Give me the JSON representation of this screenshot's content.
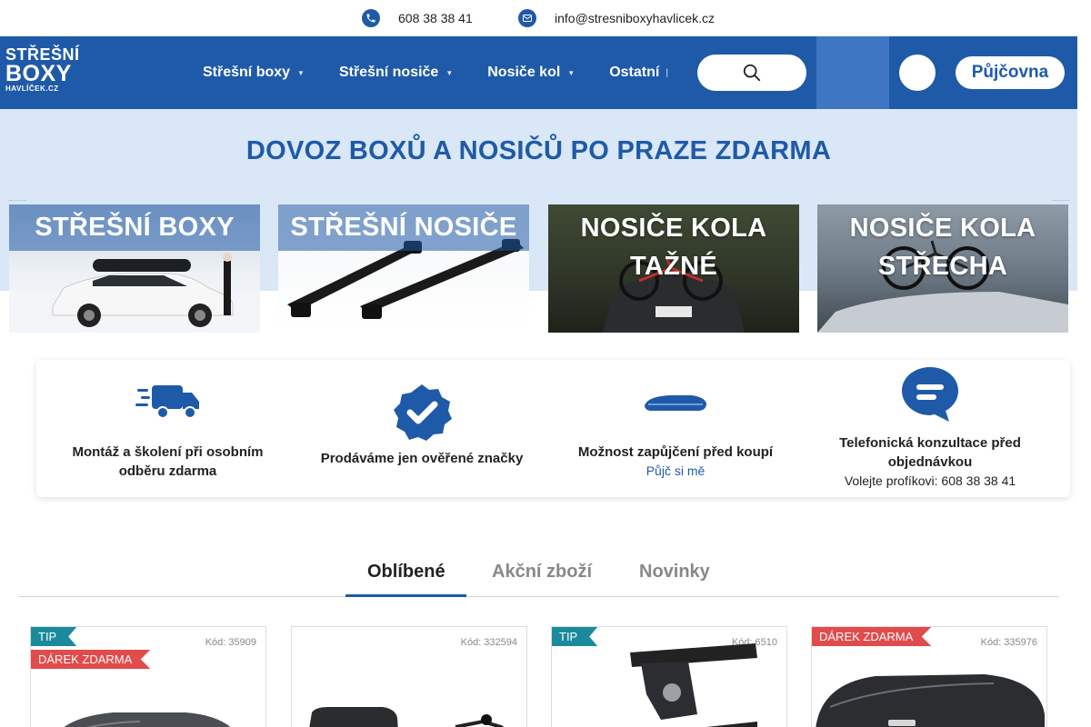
{
  "contact": {
    "phone": "608 38 38 41",
    "email": "info@stresniboxyhavlicek.cz"
  },
  "logo": {
    "line1": "STŘEŠNÍ",
    "line2": "BOXY",
    "line3": "HAVLÍČEK.CZ"
  },
  "nav": {
    "items": [
      {
        "label": "Střešní boxy"
      },
      {
        "label": "Střešní nosiče"
      },
      {
        "label": "Nosiče kol"
      },
      {
        "label": "Ostatní"
      }
    ],
    "rent_label": "Půjčovna",
    "user_glyph": "",
    "cart_glyph": ""
  },
  "hero": {
    "title": "DOVOZ BOXŮ A NOSIČŮ PO PRAZE ZDARMA",
    "categories": [
      {
        "title": "STŘEŠNÍ BOXY"
      },
      {
        "title": "STŘEŠNÍ NOSIČE"
      },
      {
        "title": "NOSIČE KOLA TAŽNÉ"
      },
      {
        "title": "NOSIČE KOLA STŘECHA"
      }
    ]
  },
  "benefits": [
    {
      "text": "Montáž a školení při osobním odběru zdarma"
    },
    {
      "text": "Prodáváme jen ověřené značky"
    },
    {
      "text": "Možnost zapůjčení před koupí",
      "link": "Půjč si mě"
    },
    {
      "text": "Telefonická konzultace před objednávkou",
      "sub": "Volejte profíkovi: 608 38 38 41"
    }
  ],
  "tabs": [
    {
      "label": "Oblíbené",
      "active": true
    },
    {
      "label": "Akční zboží",
      "active": false
    },
    {
      "label": "Novinky",
      "active": false
    }
  ],
  "products": [
    {
      "code": "Kód: 35909",
      "badges": [
        "TIP",
        "DÁREK ZDARMA"
      ]
    },
    {
      "code": "Kód: 332594",
      "badges": []
    },
    {
      "code": "Kód: 6510",
      "badges": [
        "TIP"
      ]
    },
    {
      "code": "Kód: 335976",
      "badges": [
        "DÁREK ZDARMA"
      ]
    }
  ],
  "colors": {
    "brand_blue": "#1f5aa8",
    "hero_bg": "#d9e7f6",
    "tip_badge": "#1b8a9c",
    "gift_badge": "#e24b4b"
  }
}
